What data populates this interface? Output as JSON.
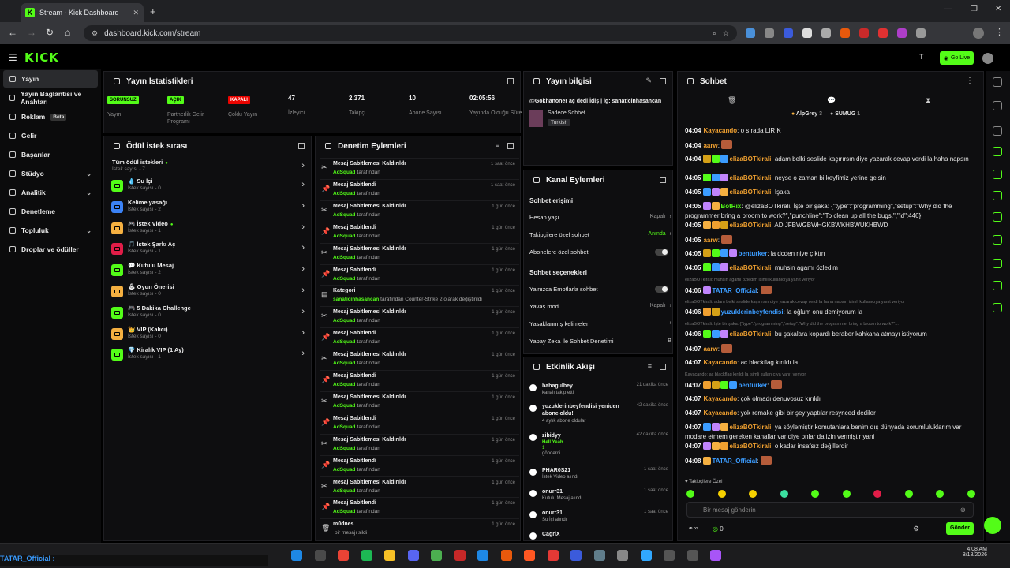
{
  "browser": {
    "tab_title": "Stream - Kick Dashboard",
    "url": "dashboard.kick.com/stream"
  },
  "app": {
    "logo": "KICK",
    "go_live": "Go Live"
  },
  "sidebar": [
    {
      "label": "Yayın",
      "selected": true
    },
    {
      "label": "Yayın Bağlantısı ve Anahtarı"
    },
    {
      "label": "Reklam",
      "badge": "Beta"
    },
    {
      "label": "Gelir"
    },
    {
      "label": "Başarılar"
    },
    {
      "label": "Stüdyo",
      "chev": "⌄"
    },
    {
      "label": "Analitik",
      "chev": "⌄"
    },
    {
      "label": "Denetleme"
    },
    {
      "label": "Topluluk",
      "chev": "⌄"
    },
    {
      "label": "Droplar ve ödüller"
    }
  ],
  "stats_panel": {
    "title": "Yayın İstatistikleri",
    "items": [
      {
        "badge": "SORUNSUZ",
        "badge_color": "#53fc18",
        "label": "Yayın"
      },
      {
        "badge": "AÇIK",
        "badge_color": "#53fc18",
        "label": "Partnerlik Gelir Programı"
      },
      {
        "badge": "KAPALI",
        "badge_color": "#eb0400",
        "label": "Çoklu Yayın"
      },
      {
        "value": "47",
        "label": "İzleyici"
      },
      {
        "value": "2.371",
        "label": "Takipçi"
      },
      {
        "value": "10",
        "label": "Abone Sayısı"
      },
      {
        "value": "02:05:56",
        "label": "Yayında Olduğu Süre"
      }
    ]
  },
  "stream_info": {
    "title": "Yayın bilgisi",
    "name": "@Gokhanoner aç dedi İdiş | ig: sanaticinhasancan",
    "chat": "Sadece Sohbet",
    "lang": "Turkish"
  },
  "rewards": {
    "title": "Ödül istek sırası",
    "items": [
      {
        "title": "Tüm ödül istekleri",
        "sub": "İstek sayısı - 7",
        "dot": "●",
        "color": "none"
      },
      {
        "title": "💧 Su İçi",
        "sub": "İstek sayısı - 0",
        "color": "#53fc18"
      },
      {
        "title": "Kelime yasağı",
        "sub": "İstek sayısı - 2",
        "color": "#3b82f6"
      },
      {
        "title": "🎮 İstek Video",
        "sub": "İstek sayısı - 1",
        "dot": "●",
        "color": "#f5b041"
      },
      {
        "title": "🎵 İstek Şarkı Aç",
        "sub": "İstek sayısı - 1",
        "color": "#e11d48"
      },
      {
        "title": "💬 Kutulu Mesaj",
        "sub": "İstek sayısı - 2",
        "color": "#53fc18"
      },
      {
        "title": "🕹 Oyun Önerisi",
        "sub": "İstek sayısı - 0",
        "color": "#f5b041"
      },
      {
        "title": "🎮 5 Dakika Challenge",
        "sub": "İstek sayısı - 0",
        "color": "#53fc18"
      },
      {
        "title": "👑 VIP (Kalıcı)",
        "sub": "İstek sayısı - 0",
        "color": "#f5b041"
      },
      {
        "title": "💎 Kiralık VIP (1 Ay)",
        "sub": "İstek sayısı - 1",
        "color": "#53fc18"
      }
    ]
  },
  "moderation": {
    "title": "Denetim Eylemleri",
    "rows": [
      {
        "icon": "✂",
        "t": "Mesaj Sabitlemesi Kaldırıldı",
        "u": "AdSquad",
        "s": "tarafından",
        "d": "1 saat önce"
      },
      {
        "icon": "📌",
        "t": "Mesaj Sabitlendi",
        "u": "AdSquad",
        "s": "tarafından",
        "d": "1 saat önce"
      },
      {
        "icon": "✂",
        "t": "Mesaj Sabitlemesi Kaldırıldı",
        "u": "AdSquad",
        "s": "tarafından",
        "d": "1 gün önce"
      },
      {
        "icon": "📌",
        "t": "Mesaj Sabitlendi",
        "u": "AdSquad",
        "s": "tarafından",
        "d": "1 gün önce"
      },
      {
        "icon": "✂",
        "t": "Mesaj Sabitlemesi Kaldırıldı",
        "u": "AdSquad",
        "s": "tarafından",
        "d": "1 gün önce"
      },
      {
        "icon": "📌",
        "t": "Mesaj Sabitlendi",
        "u": "AdSquad",
        "s": "tarafından",
        "d": "1 gün önce"
      },
      {
        "icon": "▤",
        "t": "Kategori",
        "u": "sanaticinhasancan",
        "s": "tarafından Counter-Strike 2 olarak değiştirildi",
        "d": "1 gün önce"
      },
      {
        "icon": "✂",
        "t": "Mesaj Sabitlemesi Kaldırıldı",
        "u": "AdSquad",
        "s": "tarafından",
        "d": "1 gün önce"
      },
      {
        "icon": "📌",
        "t": "Mesaj Sabitlendi",
        "u": "AdSquad",
        "s": "tarafından",
        "d": "1 gün önce"
      },
      {
        "icon": "✂",
        "t": "Mesaj Sabitlemesi Kaldırıldı",
        "u": "AdSquad",
        "s": "tarafından",
        "d": "1 gün önce"
      },
      {
        "icon": "📌",
        "t": "Mesaj Sabitlendi",
        "u": "AdSquad",
        "s": "tarafından",
        "d": "1 gün önce"
      },
      {
        "icon": "✂",
        "t": "Mesaj Sabitlemesi Kaldırıldı",
        "u": "AdSquad",
        "s": "tarafından",
        "d": "1 gün önce"
      },
      {
        "icon": "📌",
        "t": "Mesaj Sabitlendi",
        "u": "AdSquad",
        "s": "tarafından",
        "d": "1 gün önce"
      },
      {
        "icon": "✂",
        "t": "Mesaj Sabitlemesi Kaldırıldı",
        "u": "AdSquad",
        "s": "tarafından",
        "d": "1 gün önce"
      },
      {
        "icon": "📌",
        "t": "Mesaj Sabitlendi",
        "u": "AdSquad",
        "s": "tarafından",
        "d": "1 gün önce"
      },
      {
        "icon": "✂",
        "t": "Mesaj Sabitlemesi Kaldırıldı",
        "u": "AdSquad",
        "s": "tarafından",
        "d": "1 gün önce"
      },
      {
        "icon": "📌",
        "t": "Mesaj Sabitlendi",
        "u": "AdSquad",
        "s": "tarafından",
        "d": "1 gün önce"
      },
      {
        "icon": "🗑",
        "t": "m0dnes",
        "u": "",
        "s": "bir mesajı sildi",
        "d": "1 gün önce"
      }
    ]
  },
  "channel_actions": {
    "title": "Kanal Eylemleri",
    "sec1": "Sohbet erişimi",
    "sec2": "Sohbet seçenekleri",
    "rows": [
      {
        "l": "Hesap yaşı",
        "v": "Kapalı",
        "k": "arrow"
      },
      {
        "l": "Takipçilere özel sohbet",
        "v": "Anında",
        "k": "arrow",
        "green": true
      },
      {
        "l": "Abonelere özel sohbet",
        "k": "toggle"
      },
      {
        "l": "Yalnızca Emotlarla sohbet",
        "k": "toggle"
      },
      {
        "l": "Yavaş mod",
        "v": "Kapalı",
        "k": "arrow"
      },
      {
        "l": "Yasaklanmış kelimeler",
        "k": "arrow"
      },
      {
        "l": "Yapay Zeka ile Sohbet Denetimi",
        "k": "ext"
      }
    ]
  },
  "activity": {
    "title": "Etkinlik Akışı",
    "rows": [
      {
        "t": "bahagulbey",
        "s": "kanalı takip etti",
        "d": "21 dakika önce"
      },
      {
        "t": "yuzuklerinbeyfendisi yeniden abone oldu!",
        "s": "4 aylık abone oldular",
        "d": "42 dakika önce"
      },
      {
        "t": "zibidyy",
        "s": "Hell Yeah",
        "s2": "1",
        "s3": "gönderdi",
        "d": "42 dakika önce"
      },
      {
        "t": "PHAR0S21",
        "s": "İstek Video alındı",
        "d": "1 saat önce"
      },
      {
        "t": "onurr31",
        "s": "Kutulu Mesaj alındı",
        "d": "1 saat önce"
      },
      {
        "t": "onurr31",
        "s": "Su İçi alındı",
        "d": "1 saat önce"
      },
      {
        "t": "CagriX",
        "s": "",
        "d": ""
      }
    ]
  },
  "chat": {
    "title": "Sohbet",
    "leaders": [
      {
        "n": "AlpGrey",
        "c": "3"
      },
      {
        "n": "SUMUG",
        "c": "1"
      }
    ],
    "messages": [
      {
        "time": "04:04",
        "user": "Kayacando",
        "color": "#f0a030",
        "text": "o sırada LIRIK"
      },
      {
        "time": "04:04",
        "user": "aarw",
        "color": "#f0a030",
        "text": "",
        "img": true
      },
      {
        "time": "04:04",
        "user": "elizaBOTkirali",
        "color": "#f0a030",
        "text": "adam belki seslide kaçırırsın diye yazarak cevap verdi la haha napsın",
        "badges": 3
      },
      {
        "time": "04:05",
        "user": "elizaBOTkirali",
        "color": "#f0a030",
        "text": "neyse o zaman bi keyfimiz yerine gelsin",
        "badges": 3
      },
      {
        "time": "04:05",
        "user": "elizaBOTkirali",
        "color": "#f0a030",
        "text": "Işaka",
        "badges": 3
      },
      {
        "time": "04:05",
        "user": "BotRix",
        "color": "#53fc18",
        "text": "@elizaBOTkirali, İşte bir şaka: {\"type\":\"programming\",\"setup\":\"Why did the programmer bring a broom to work?\",\"punchline\":\"To clean up all the bugs.\",\"id\":446}",
        "badges": 2
      },
      {
        "time": "04:05",
        "user": "elizaBOTkirali",
        "color": "#f0a030",
        "text": "ADIJFBWGBWHGKBWKHBWUKHBWD",
        "badges": 3
      },
      {
        "time": "04:05",
        "user": "aarw",
        "color": "#f0a030",
        "text": "",
        "img": true
      },
      {
        "time": "04:05",
        "user": "benturker",
        "color": "#3b9cff",
        "text": "la dcden niye çıktın",
        "badges": 4
      },
      {
        "time": "04:05",
        "user": "elizaBOTkirali",
        "color": "#f0a030",
        "text": "muhsin agamı özledim",
        "badges": 3
      },
      {
        "reply": "elizaBOTkirali: muhsin agamı özledim isimli kullanıcıya yanıt veriyor"
      },
      {
        "time": "04:06",
        "user": "TATAR_Official",
        "color": "#3b9cff",
        "text": "",
        "img": true,
        "badges": 1
      },
      {
        "reply": "elizaBOTkirali: adam belki seslide kaçırırsın diye yazarak cevap verdi la haha napsın isimli kullanıcıya yanıt veriyor"
      },
      {
        "time": "04:06",
        "user": "yuzuklerinbeyfendisi",
        "color": "#3b9cff",
        "text": "la oğlum onu demiyorum la",
        "badges": 2
      },
      {
        "reply": "elizaBOTkirali: İşte bir şaka: {\"type\":\"programming\",\"setup\":\"Why did the programmer bring a broom to work?\"..."
      },
      {
        "time": "04:06",
        "user": "elizaBOTkirali",
        "color": "#f0a030",
        "text": "bu şakalara kopardı beraber kahkaha atmayı istiyorum",
        "badges": 3
      },
      {
        "time": "04:07",
        "user": "aarw",
        "color": "#f0a030",
        "text": "",
        "img": true
      },
      {
        "time": "04:07",
        "user": "Kayacando",
        "color": "#f0a030",
        "text": "ac blackflag kırıldı la"
      },
      {
        "reply": "Kayacando: ac blackflag kırıldı la isimli kullanıcıya yanıt veriyor"
      },
      {
        "time": "04:07",
        "user": "benturker",
        "color": "#3b9cff",
        "text": "",
        "img": true,
        "badges": 4
      },
      {
        "time": "04:07",
        "user": "Kayacando",
        "color": "#f0a030",
        "text": "çok olmadı denuvosuz kırıldı"
      },
      {
        "time": "04:07",
        "user": "Kayacando",
        "color": "#f0a030",
        "text": "yok remake gibi bir şey yaptılar resynced dediler"
      },
      {
        "time": "04:07",
        "user": "elizaBOTkirali",
        "color": "#f0a030",
        "text": "ya söylemiştir komutanlara benim dış dünyada sorumluluklarım var modare etmem gereken kanallar var diye onlar da izin vermiştir yani",
        "badges": 3
      },
      {
        "time": "04:07",
        "user": "elizaBOTkirali",
        "color": "#f0a030",
        "text": "o kadar insafsız değillerdir",
        "badges": 3
      },
      {
        "time": "04:08",
        "user": "TATAR_Official",
        "color": "#3b9cff",
        "text": "",
        "img": true,
        "badges": 1
      }
    ],
    "follow_only": "Takipçilere Özel",
    "input_placeholder": "Bir mesaj gönderin",
    "send": "Gönder",
    "count": "0"
  },
  "taskbar": {
    "time": "4:08 AM",
    "date": "8/18/2026",
    "notif": "TATAR_Official :"
  }
}
